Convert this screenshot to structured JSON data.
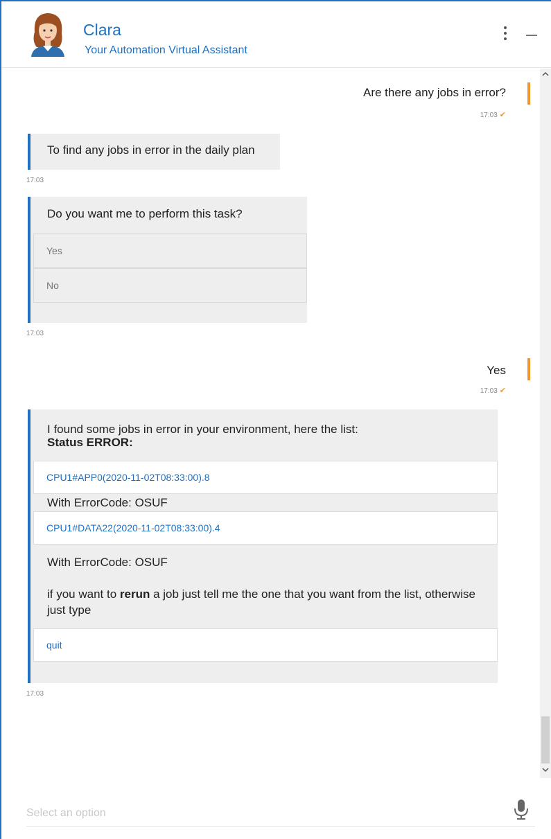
{
  "header": {
    "title": "Clara",
    "subtitle": "Your Automation Virtual Assistant"
  },
  "messages": {
    "user1": {
      "text": "Are there any jobs in error?",
      "time": "17:03"
    },
    "bot1": {
      "text": "To find any jobs in error in the daily plan",
      "time": "17:03"
    },
    "bot2": {
      "text": "Do you want me to perform this task?",
      "options": [
        "Yes",
        "No"
      ],
      "time": "17:03"
    },
    "user2": {
      "text": "Yes",
      "time": "17:03"
    },
    "bot3": {
      "intro": "I found some jobs in error in your environment, here the list:",
      "status": "Status ERROR:",
      "jobs": [
        {
          "link": "CPU1#APP0(2020-11-02T08:33:00).8",
          "code": "With ErrorCode: OSUF"
        },
        {
          "link": "CPU1#DATA22(2020-11-02T08:33:00).4",
          "code": "With ErrorCode: OSUF"
        }
      ],
      "rerun_prefix": "if you want to ",
      "rerun_bold": "rerun",
      "rerun_suffix": " a job just tell me the one that you want from the list, otherwise just type",
      "quit": "quit",
      "time": "17:03"
    }
  },
  "input": {
    "placeholder": "Select an option"
  },
  "colors": {
    "accent": "#1f70c1",
    "user_bar": "#f3952d",
    "bubble": "#eeeeee"
  },
  "icons": {
    "menu": "more-vertical-icon",
    "minimize": "minimize-icon",
    "mic": "microphone-icon"
  }
}
